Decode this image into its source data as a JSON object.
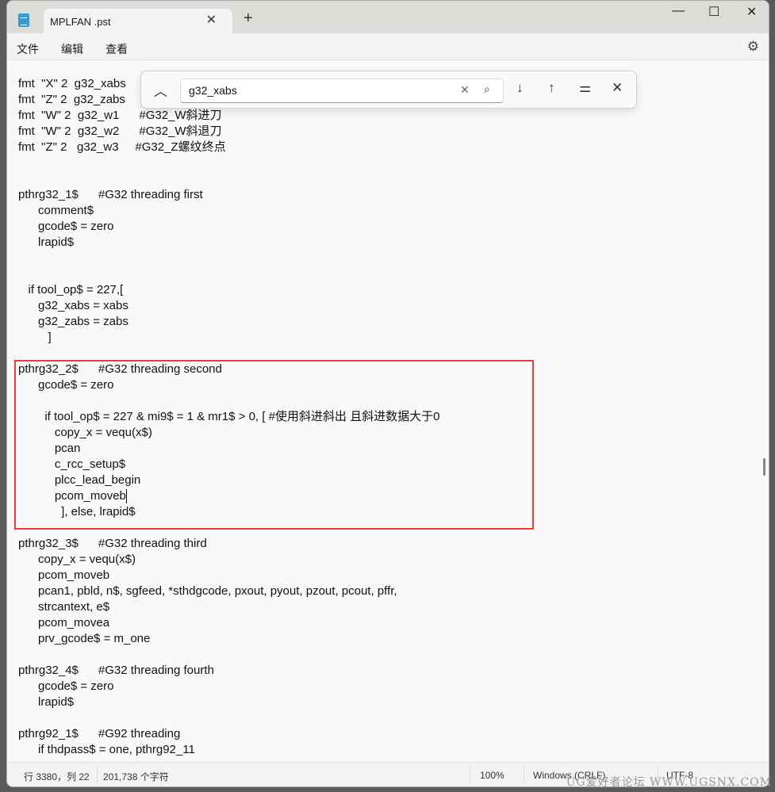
{
  "window": {
    "tab_title": "MPLFAN .pst",
    "new_tab": "+",
    "minimize": "—",
    "maximize": "☐",
    "close": "✕"
  },
  "menu": {
    "items": [
      "文件",
      "编辑",
      "查看"
    ]
  },
  "find": {
    "query": "g32_xabs"
  },
  "editor": {
    "lines": [
      "fmt  \"X\" 2  g32_xabs",
      "fmt  \"Z\" 2  g32_zabs",
      "fmt  \"W\" 2  g32_w1      #G32_W斜进刀",
      "fmt  \"W\" 2  g32_w2      #G32_W斜退刀",
      "fmt  \"Z\" 2   g32_w3     #G32_Z螺纹终点",
      "",
      "",
      "pthrg32_1$      #G32 threading first",
      "      comment$",
      "      gcode$ = zero",
      "      lrapid$",
      "",
      "",
      "   if tool_op$ = 227,[",
      "      g32_xabs = xabs",
      "      g32_zabs = zabs",
      "         ]",
      "",
      "pthrg32_2$      #G32 threading second",
      "      gcode$ = zero",
      "",
      "        if tool_op$ = 227 & mi9$ = 1 & mr1$ > 0, [ #使用斜进斜出 且斜进数据大于0",
      "           copy_x = vequ(x$)",
      "           pcan",
      "           c_rcc_setup$",
      "           plcc_lead_begin",
      "           pcom_moveb",
      "             ], else, lrapid$",
      "",
      "pthrg32_3$      #G32 threading third",
      "      copy_x = vequ(x$)",
      "      pcom_moveb",
      "      pcan1, pbld, n$, sgfeed, *sthdgcode, pxout, pyout, pzout, pcout, pffr,",
      "      strcantext, e$",
      "      pcom_movea",
      "      prv_gcode$ = m_one",
      "",
      "pthrg32_4$      #G32 threading fourth",
      "      gcode$ = zero",
      "      lrapid$",
      "",
      "pthrg92_1$      #G92 threading",
      "      if thdpass$ = one, pthrg92_11"
    ]
  },
  "status": {
    "position": "行 3380，列 22",
    "chars": "201,738 个字符",
    "zoom": "100%",
    "line_ending": "Windows (CRLF)",
    "encoding": "UTF-8"
  },
  "watermark": "UG爱好者论坛 WWW.UGSNX.COM",
  "colors": {
    "highlight_box": "#f03a3a"
  }
}
